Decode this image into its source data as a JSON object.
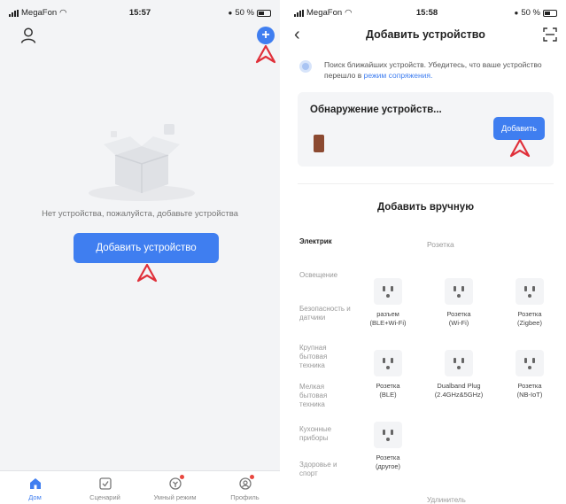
{
  "left": {
    "status": {
      "carrier": "MegaFon",
      "time": "15:57",
      "battery": "50 %"
    },
    "empty_text": "Нет устройства, пожалуйста, добавьте устройства",
    "add_device_label": "Добавить устройство",
    "tabs": [
      {
        "label": "Дом",
        "icon": "home-icon",
        "active": true
      },
      {
        "label": "Сценарий",
        "icon": "scenario-icon",
        "active": false
      },
      {
        "label": "Умный режим",
        "icon": "smart-icon",
        "active": false
      },
      {
        "label": "Профиль",
        "icon": "profile-icon",
        "active": false
      }
    ],
    "colors": {
      "accent": "#3f7ef0",
      "annotation": "#e0303a"
    }
  },
  "right": {
    "status": {
      "carrier": "MegaFon",
      "time": "15:58",
      "battery": "50 %"
    },
    "title": "Добавить устройство",
    "search_text": "Поиск ближайших устройств. Убедитесь, что ваше устройство перешло в",
    "search_link": "режим сопряжения.",
    "discovery_title": "Обнаружение устройств...",
    "discovery_button": "Добавить",
    "manual_title": "Добавить вручную",
    "categories": [
      {
        "label": "Электрик",
        "active": true
      },
      {
        "label": "Освещение",
        "active": false
      },
      {
        "label": "Безопасность и датчики",
        "active": false
      },
      {
        "label": "Крупная бытовая техника",
        "active": false
      },
      {
        "label": "Мелкая бытовая техника",
        "active": false
      },
      {
        "label": "Кухонные приборы",
        "active": false
      },
      {
        "label": "Здоровье и спорт",
        "active": false
      }
    ],
    "group_title": "Розетка",
    "devices": [
      {
        "name": "разъем",
        "sub": "(BLE+Wi-Fi)"
      },
      {
        "name": "Розетка",
        "sub": "(Wi-Fi)"
      },
      {
        "name": "Розетка",
        "sub": "(Zigbee)"
      },
      {
        "name": "Розетка",
        "sub": "(BLE)"
      },
      {
        "name": "Dualband Plug",
        "sub": "(2.4GHz&5GHz)"
      },
      {
        "name": "Розетка",
        "sub": "(NB-IoT)"
      },
      {
        "name": "Розетка",
        "sub": "(другое)"
      }
    ],
    "bottom_partial": "Удлинитель"
  }
}
